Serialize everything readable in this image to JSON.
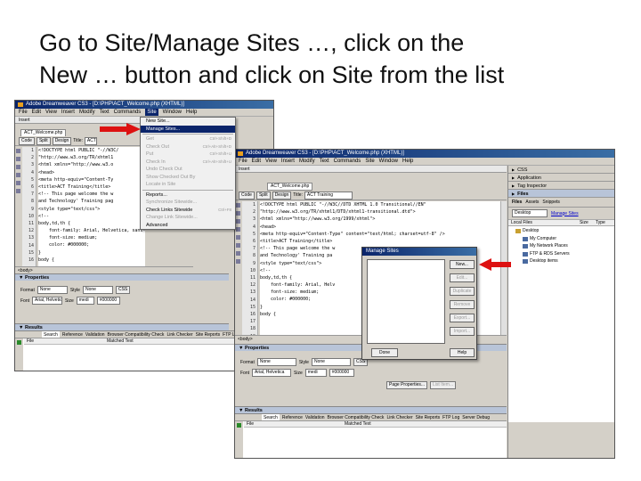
{
  "slide": {
    "title_line1": "Go to Site/Manage Sites …, click on the",
    "title_line2": "New … button and click on Site from the list"
  },
  "colors": {
    "arrow": "#dd1111",
    "titlebar": "#0a246a",
    "highlight": "#0a246a"
  },
  "win1": {
    "title": "Adobe Dreamweaver CS3 - [D:\\PHP\\ACT_Welcome.php (XHTML)]",
    "menus": [
      "File",
      "Edit",
      "View",
      "Insert",
      "Modify",
      "Text",
      "Commands",
      "Site",
      "Window",
      "Help"
    ],
    "active_menu": "Site",
    "insert_label": "Insert",
    "doc_tab": "ACT_Welcome.php",
    "toolbar": {
      "code": "Code",
      "split": "Split",
      "design": "Design",
      "title_label": "Title:",
      "title_value": "ACT"
    },
    "line_numbers": [
      "1",
      "2",
      "3",
      "4",
      "5",
      "6",
      "7",
      "8",
      "9",
      "10",
      "11",
      "12",
      "13",
      "14",
      "15",
      "16"
    ],
    "code_lines": [
      "<!DOCTYPE html PUBLIC \"-//W3C/",
      "\"http://www.w3.org/TR/xhtml1",
      "<html xmlns=\"http://www.w3.o",
      "<head>",
      "<meta http-equiv=\"Content-Ty",
      "<title>ACT Training</title>",
      "<!-- This page welcome the w",
      "and Technology' Training pag",
      "<style type=\"text/css\">",
      "<!--",
      "body,td,th {",
      "    font-family: Arial, Helvetica, sans-serif;",
      "    font-size: medium;",
      "    color: #000000;",
      "}",
      "body {"
    ],
    "status": "<body>",
    "properties": {
      "header": "Properties",
      "format_label": "Format",
      "format_value": "None",
      "style_label": "Style",
      "style_value": "None",
      "css": "CSS",
      "font_label": "Font",
      "font_value": "Arial, Helvetica",
      "size_label": "Size",
      "size_value": "medi",
      "color_value": "#000000"
    },
    "results": {
      "header": "Results",
      "tabs": [
        "Search",
        "Reference",
        "Validation",
        "Browser Compatibility Check",
        "Link Checker",
        "Site Reports",
        "FTP Log"
      ],
      "col_file": "File",
      "col_matched": "Matched Text"
    },
    "right_panels": [
      "CSS",
      "Application",
      "Tag Inspector"
    ]
  },
  "site_menu": {
    "items": [
      {
        "label": "New Site...",
        "disabled": false,
        "highlight": false,
        "shortcut": ""
      },
      {
        "label": "Manage Sites...",
        "disabled": false,
        "highlight": true,
        "shortcut": ""
      },
      {
        "sep": true
      },
      {
        "label": "Get",
        "disabled": true,
        "highlight": false,
        "shortcut": "Ctrl+Shift+D"
      },
      {
        "label": "Check Out",
        "disabled": true,
        "highlight": false,
        "shortcut": "Ctrl+Alt+Shift+D"
      },
      {
        "label": "Put",
        "disabled": true,
        "highlight": false,
        "shortcut": "Ctrl+Shift+U"
      },
      {
        "label": "Check In",
        "disabled": true,
        "highlight": false,
        "shortcut": "Ctrl+Alt+Shift+U"
      },
      {
        "label": "Undo Check Out",
        "disabled": true,
        "highlight": false,
        "shortcut": ""
      },
      {
        "label": "Show Checked Out By",
        "disabled": true,
        "highlight": false,
        "shortcut": ""
      },
      {
        "label": "Locate in Site",
        "disabled": true,
        "highlight": false,
        "shortcut": ""
      },
      {
        "sep": true
      },
      {
        "label": "Reports...",
        "disabled": false,
        "highlight": false,
        "shortcut": ""
      },
      {
        "label": "Synchronize Sitewide...",
        "disabled": true,
        "highlight": false,
        "shortcut": ""
      },
      {
        "label": "Check Links Sitewide",
        "disabled": false,
        "highlight": false,
        "shortcut": "Ctrl+F8"
      },
      {
        "label": "Change Link Sitewide...",
        "disabled": true,
        "highlight": false,
        "shortcut": ""
      },
      {
        "label": "Advanced",
        "disabled": false,
        "highlight": false,
        "shortcut": ""
      }
    ]
  },
  "win2": {
    "title": "Adobe Dreamweaver CS3 - [D:\\PHP\\ACT_Welcome.php (XHTML)]",
    "menus": [
      "File",
      "Edit",
      "View",
      "Insert",
      "Modify",
      "Text",
      "Commands",
      "Site",
      "Window",
      "Help"
    ],
    "insert_label": "Insert",
    "doc_tab": "ACT_Welcome.php",
    "toolbar": {
      "code": "Code",
      "split": "Split",
      "design": "Design",
      "title_label": "Title:",
      "title_value": "ACT Training"
    },
    "line_numbers": [
      "1",
      "2",
      "3",
      "4",
      "5",
      "6",
      "7",
      "8",
      "9",
      "10",
      "11",
      "12",
      "13",
      "14",
      "15",
      "16",
      "17",
      "18",
      "19"
    ],
    "code_lines": [
      "<!DOCTYPE html PUBLIC \"-//W3C//DTD XHTML 1.0 Transitional//EN\"",
      "\"http://www.w3.org/TR/xhtml1/DTD/xhtml1-transitional.dtd\">",
      "<html xmlns=\"http://www.w3.org/1999/xhtml\">",
      "<head>",
      "<meta http-equiv=\"Content-Type\" content=\"text/html; charset=utf-8\" />",
      "<title>ACT Training</title>",
      "<!-- This page welcome the w",
      "and Technology' Training pa",
      "<style type=\"text/css\">",
      "<!--",
      "body,td,th {",
      "    font-family: Arial, Helv",
      "    font-size: medium;",
      "    color: #000000;",
      "}",
      "body {",
      "",
      "",
      ""
    ],
    "status": "<body>",
    "properties": {
      "header": "Properties",
      "format_label": "Format",
      "format_value": "None",
      "style_label": "Style",
      "style_value": "None",
      "css": "CSS",
      "font_label": "Font",
      "font_value": "Arial, Helvetica",
      "size_label": "Size",
      "size_value": "medi",
      "color_value": "#000000",
      "page_props": "Page Properties...",
      "list_item": "List Item..."
    },
    "results": {
      "header": "Results",
      "tabs": [
        "Search",
        "Reference",
        "Validation",
        "Browser Compatibility Check",
        "Link Checker",
        "Site Reports",
        "FTP Log",
        "Server Debug"
      ],
      "col_file": "File",
      "col_matched": "Matched Text"
    },
    "right_panels": [
      "CSS",
      "Application",
      "Tag Inspector"
    ],
    "files_panel": {
      "header": "Files",
      "tabs": [
        "Files",
        "Assets",
        "Snippets"
      ],
      "site_select": "Desktop",
      "manage_link": "Manage Sites",
      "col_local": "Local Files",
      "col_size": "Size",
      "col_type": "Type",
      "tree": [
        "Desktop",
        "My Computer",
        "My Network Places",
        "FTP & RDS Servers",
        "Desktop items"
      ]
    }
  },
  "dialog": {
    "title": "Manage Sites",
    "buttons": [
      "New...",
      "Edit...",
      "Duplicate",
      "Remove",
      "Export...",
      "Import..."
    ],
    "done": "Done",
    "help": "Help"
  }
}
